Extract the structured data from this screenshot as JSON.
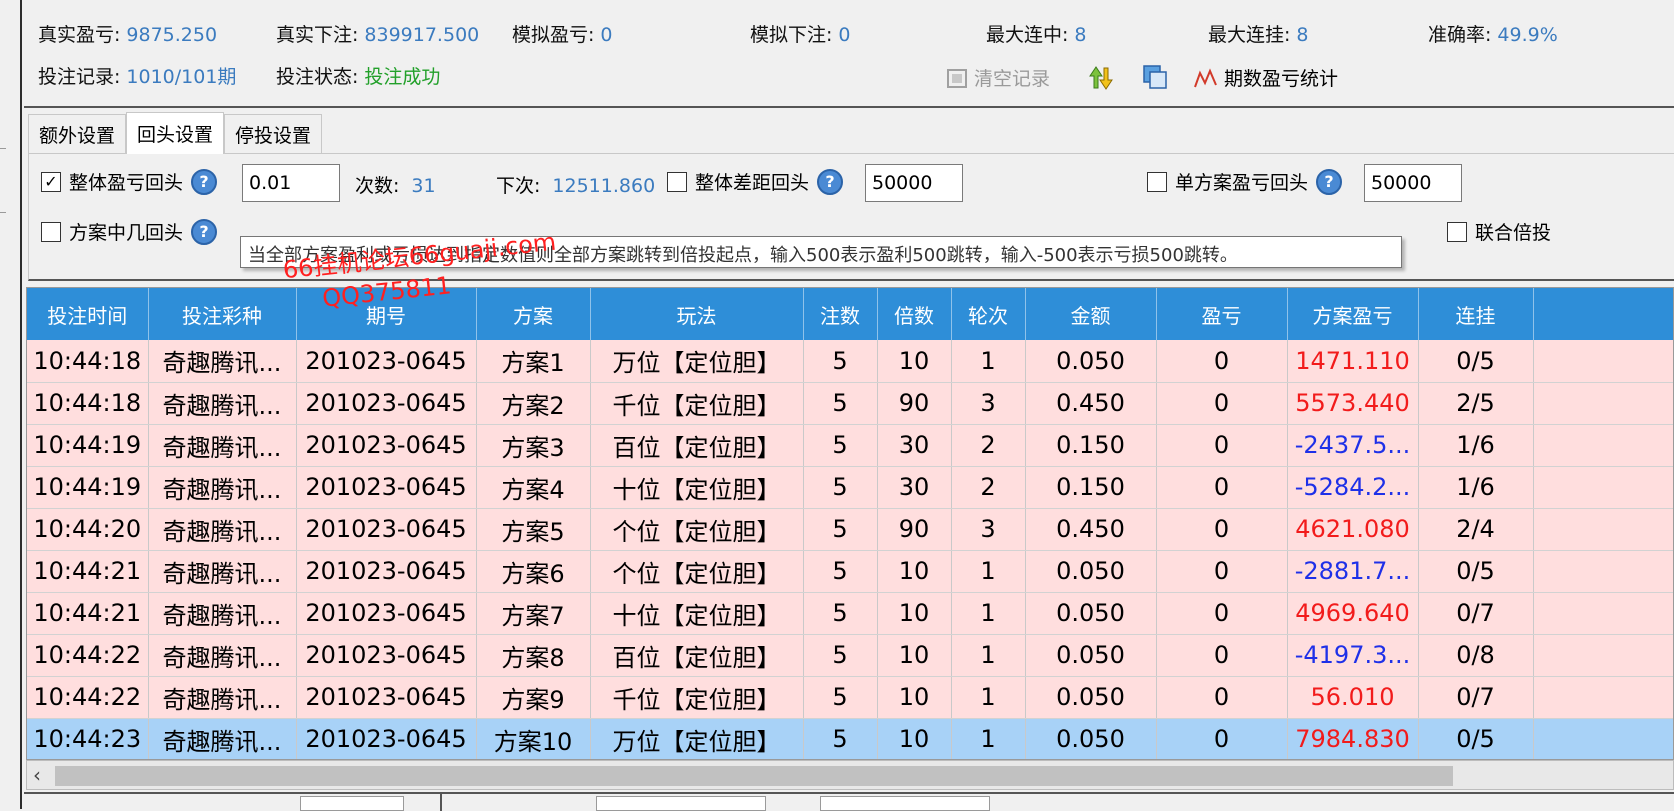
{
  "stats": {
    "real_pl_label": "真实盈亏:",
    "real_pl": "9875.250",
    "real_bet_label": "真实下注:",
    "real_bet": "839917.500",
    "sim_pl_label": "模拟盈亏:",
    "sim_pl": "0",
    "sim_bet_label": "模拟下注:",
    "sim_bet": "0",
    "max_win_streak_label": "最大连中:",
    "max_win_streak": "8",
    "max_lose_streak_label": "最大连挂:",
    "max_lose_streak": "8",
    "accuracy_label": "准确率:",
    "accuracy": "49.9%",
    "record_label": "投注记录:",
    "record": "1010/101期",
    "status_label": "投注状态:",
    "status": "投注成功"
  },
  "toolbar": {
    "clear_label": "清空记录",
    "stats_label": "期数盈亏统计"
  },
  "tabs": [
    "额外设置",
    "回头设置",
    "停投设置"
  ],
  "settings": {
    "overall_pl_label": "整体盈亏回头",
    "overall_pl_value": "0.01",
    "count_label": "次数:",
    "count_value": "31",
    "next_label": "下次:",
    "next_value": "12511.860",
    "overall_gap_label": "整体差距回头",
    "overall_gap_value": "50000",
    "single_plan_label": "单方案盈亏回头",
    "single_plan_value": "50000",
    "plan_hit_label": "方案中几回头",
    "joint_label": "联合倍投"
  },
  "tooltip": "当全部方案盈利或亏损达到指定数值则全部方案跳转到倍投起点，输入500表示盈利500跳转，输入-500表示亏损500跳转。",
  "watermark": {
    "line1": "66挂机论坛66guaji.com",
    "line2": "QQ375811"
  },
  "table": {
    "headers": [
      "投注时间",
      "投注彩种",
      "期号",
      "方案",
      "玩法",
      "注数",
      "倍数",
      "轮次",
      "金额",
      "盈亏",
      "方案盈亏",
      "连挂",
      ""
    ],
    "rows": [
      [
        "10:44:18",
        "奇趣腾讯...",
        "201023-0645",
        "方案1",
        "万位【定位胆】",
        "5",
        "10",
        "1",
        "0.050",
        "0",
        "1471.110",
        "0/5"
      ],
      [
        "10:44:18",
        "奇趣腾讯...",
        "201023-0645",
        "方案2",
        "千位【定位胆】",
        "5",
        "90",
        "3",
        "0.450",
        "0",
        "5573.440",
        "2/5"
      ],
      [
        "10:44:19",
        "奇趣腾讯...",
        "201023-0645",
        "方案3",
        "百位【定位胆】",
        "5",
        "30",
        "2",
        "0.150",
        "0",
        "-2437.5...",
        "1/6"
      ],
      [
        "10:44:19",
        "奇趣腾讯...",
        "201023-0645",
        "方案4",
        "十位【定位胆】",
        "5",
        "30",
        "2",
        "0.150",
        "0",
        "-5284.2...",
        "1/6"
      ],
      [
        "10:44:20",
        "奇趣腾讯...",
        "201023-0645",
        "方案5",
        "个位【定位胆】",
        "5",
        "90",
        "3",
        "0.450",
        "0",
        "4621.080",
        "2/4"
      ],
      [
        "10:44:21",
        "奇趣腾讯...",
        "201023-0645",
        "方案6",
        "个位【定位胆】",
        "5",
        "10",
        "1",
        "0.050",
        "0",
        "-2881.7...",
        "0/5"
      ],
      [
        "10:44:21",
        "奇趣腾讯...",
        "201023-0645",
        "方案7",
        "十位【定位胆】",
        "5",
        "10",
        "1",
        "0.050",
        "0",
        "4969.640",
        "0/7"
      ],
      [
        "10:44:22",
        "奇趣腾讯...",
        "201023-0645",
        "方案8",
        "百位【定位胆】",
        "5",
        "10",
        "1",
        "0.050",
        "0",
        "-4197.3...",
        "0/8"
      ],
      [
        "10:44:22",
        "奇趣腾讯...",
        "201023-0645",
        "方案9",
        "千位【定位胆】",
        "5",
        "10",
        "1",
        "0.050",
        "0",
        "56.010",
        "0/7"
      ],
      [
        "10:44:23",
        "奇趣腾讯...",
        "201023-0645",
        "方案10",
        "万位【定位胆】",
        "5",
        "10",
        "1",
        "0.050",
        "0",
        "7984.830",
        "0/5"
      ]
    ],
    "selected_row": 9,
    "colors": {
      "header": "#2e8ed8",
      "row": "#ffdede",
      "selected": "#a8d2f7",
      "profit": "#f21b1b",
      "loss": "#1e30e8"
    }
  }
}
